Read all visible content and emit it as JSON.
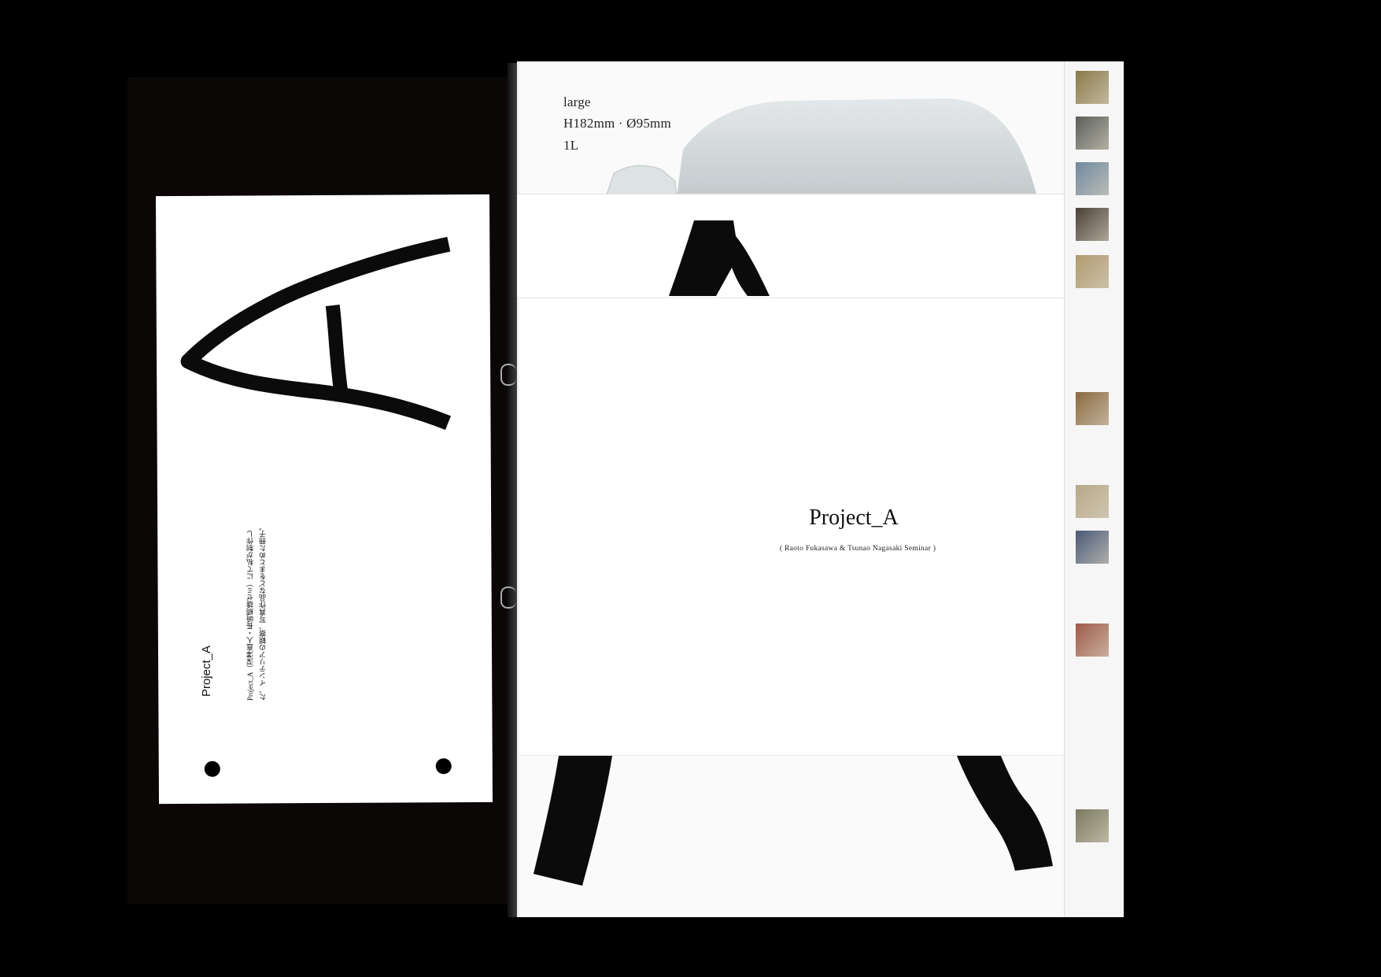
{
  "spec": {
    "size": "large",
    "dimensions": "H182mm · Ø95mm",
    "volume": "1L"
  },
  "cover": {
    "title": "Project_A",
    "subtitle": "( Raoto Fukasawa & Tsunao Nagasaki Seminar )"
  },
  "card": {
    "title": "Project_A",
    "description": "Project_A（深澤直人・長崎綱雄ゼミ）にて私が制作した、インテリアの観察、写真作品などをまとめた冊子。"
  },
  "colors": {
    "background": "#000000",
    "paper": "#ffffff",
    "ink": "#0b0b0b"
  },
  "thumbnails": [
    {
      "name": "tree-photo",
      "color": "#8a7a4a"
    },
    {
      "name": "street-photo",
      "color": "#5a5f5a"
    },
    {
      "name": "window-photo",
      "color": "#6f8aa0"
    },
    {
      "name": "people-photo",
      "color": "#4a4038"
    },
    {
      "name": "table-photo",
      "color": "#b09a70"
    },
    {
      "name": "door-photo",
      "color": "#8a6a40"
    },
    {
      "name": "vent-photo",
      "color": "#b8a888"
    },
    {
      "name": "floor-photo",
      "color": "#4a5a78"
    },
    {
      "name": "brick-photo",
      "color": "#a05a48"
    },
    {
      "name": "wall-photo",
      "color": "#7a7a60"
    }
  ]
}
